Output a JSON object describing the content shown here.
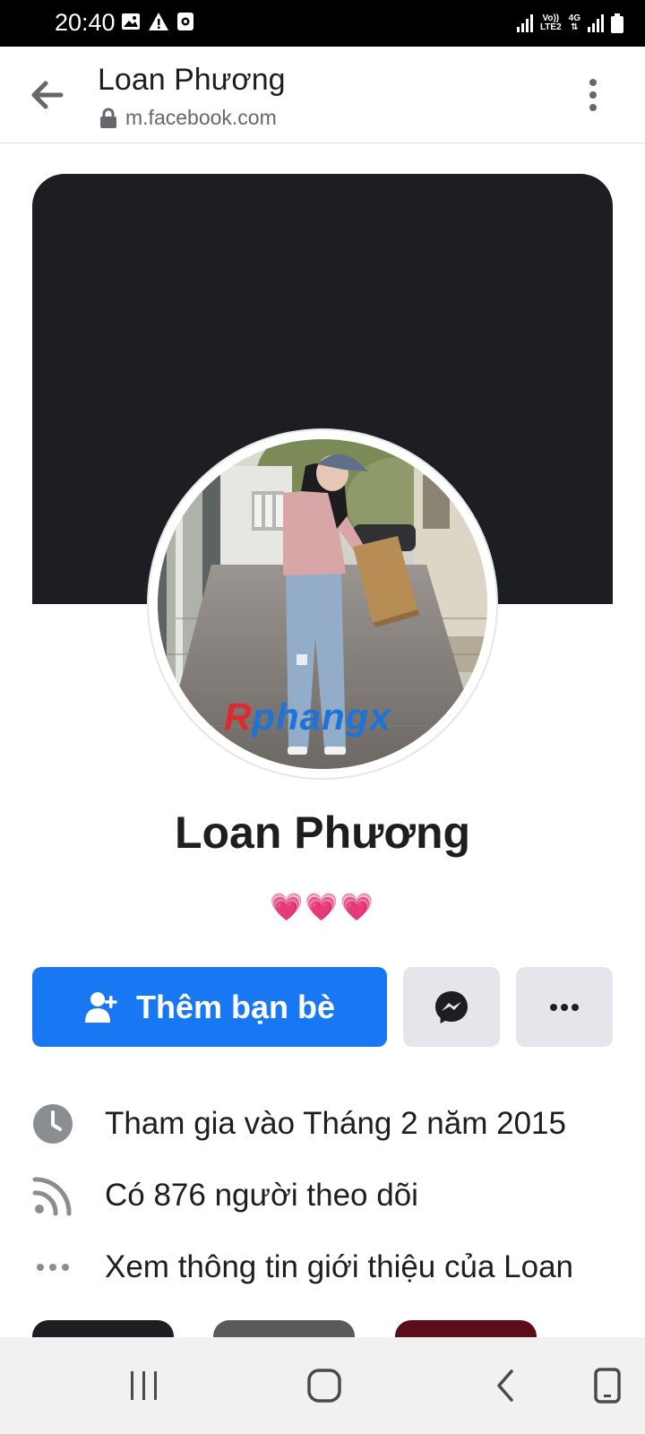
{
  "status_bar": {
    "time": "20:40",
    "volte_line1": "Vo))",
    "volte_line2": "LTE2",
    "network": "4G",
    "icons": [
      "gallery-icon",
      "warning-icon",
      "record-icon",
      "signal-icon",
      "signal-icon",
      "battery-icon"
    ]
  },
  "browser": {
    "page_title": "Loan Phương",
    "url": "m.facebook.com"
  },
  "profile": {
    "name": "Loan Phương",
    "bio": "💗💗💗",
    "watermark_part1": "R",
    "watermark_part2": "phangx"
  },
  "actions": {
    "add_friend_label": "Thêm bạn bè"
  },
  "info": {
    "joined": "Tham gia vào Tháng 2 năm 2015",
    "followers": "Có 876 người theo dõi",
    "see_about": "Xem thông tin giới thiệu của Loan"
  },
  "colors": {
    "accent": "#1877f2",
    "cover": "#1c1e21",
    "button_grey": "#e4e6eb",
    "tile_colors": [
      "#1c1e21",
      "#5a5a5a",
      "#5c0d1a"
    ]
  }
}
